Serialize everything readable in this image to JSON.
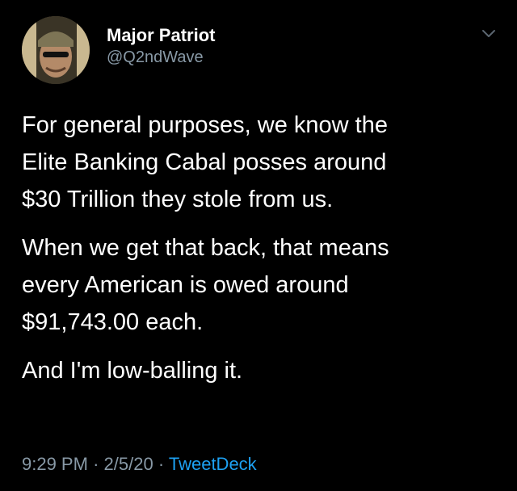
{
  "user": {
    "display_name": "Major Patriot",
    "handle": "@Q2ndWave"
  },
  "tweet": {
    "paragraphs": [
      "For general purposes, we know the\nElite Banking Cabal posses around\n$30 Trillion they stole from us.",
      "When we get that back, that means\nevery American is owed around\n$91,743.00 each.",
      "And I'm low-balling it."
    ],
    "time": "9:29 PM",
    "separator": "·",
    "date": "2/5/20",
    "source": "TweetDeck"
  },
  "icons": {
    "menu": "chevron-down-icon"
  },
  "colors": {
    "background": "#000000",
    "text": "#ffffff",
    "secondary": "#8899a6",
    "link": "#1da1f2"
  }
}
